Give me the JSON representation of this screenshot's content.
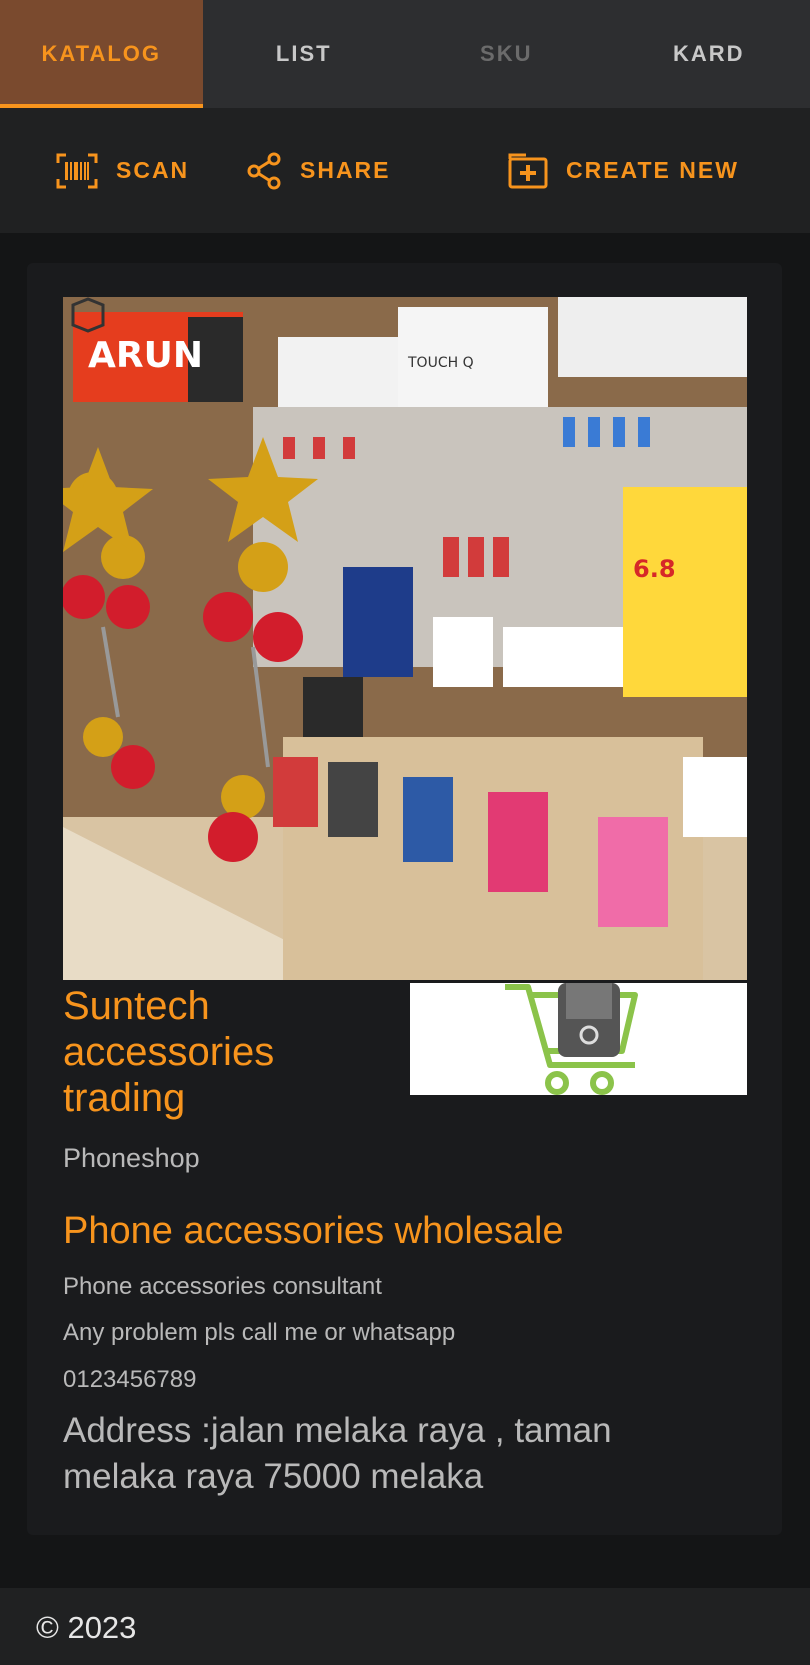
{
  "tabs": [
    {
      "label": "KATALOG",
      "state": "active"
    },
    {
      "label": "LIST",
      "state": "normal"
    },
    {
      "label": "SKU",
      "state": "disabled"
    },
    {
      "label": "KARD",
      "state": "normal"
    }
  ],
  "toolbar": {
    "scan": {
      "label": "SCAN",
      "icon": "barcode-scan-icon"
    },
    "share": {
      "label": "SHARE",
      "icon": "share-icon"
    },
    "create": {
      "label": "CREATE NEW",
      "icon": "add-box-icon"
    }
  },
  "shop": {
    "name": "Suntech accessories trading",
    "category": "Phoneshop",
    "headline": "Phone accessories wholesale",
    "lines": [
      "Phone accessories consultant",
      "Any problem pls call me or whatsapp",
      "0123456789"
    ],
    "address": "Address :jalan melaka raya , taman melaka raya 75000 melaka",
    "photo_icon": "store-photo",
    "logo_icon": "shopping-cart-phone-logo"
  },
  "footer": {
    "copyright": "© 2023"
  },
  "colors": {
    "accent": "#f7941d",
    "active_tab_bg": "#7a4a2e",
    "logo_green": "#8bc34a"
  }
}
